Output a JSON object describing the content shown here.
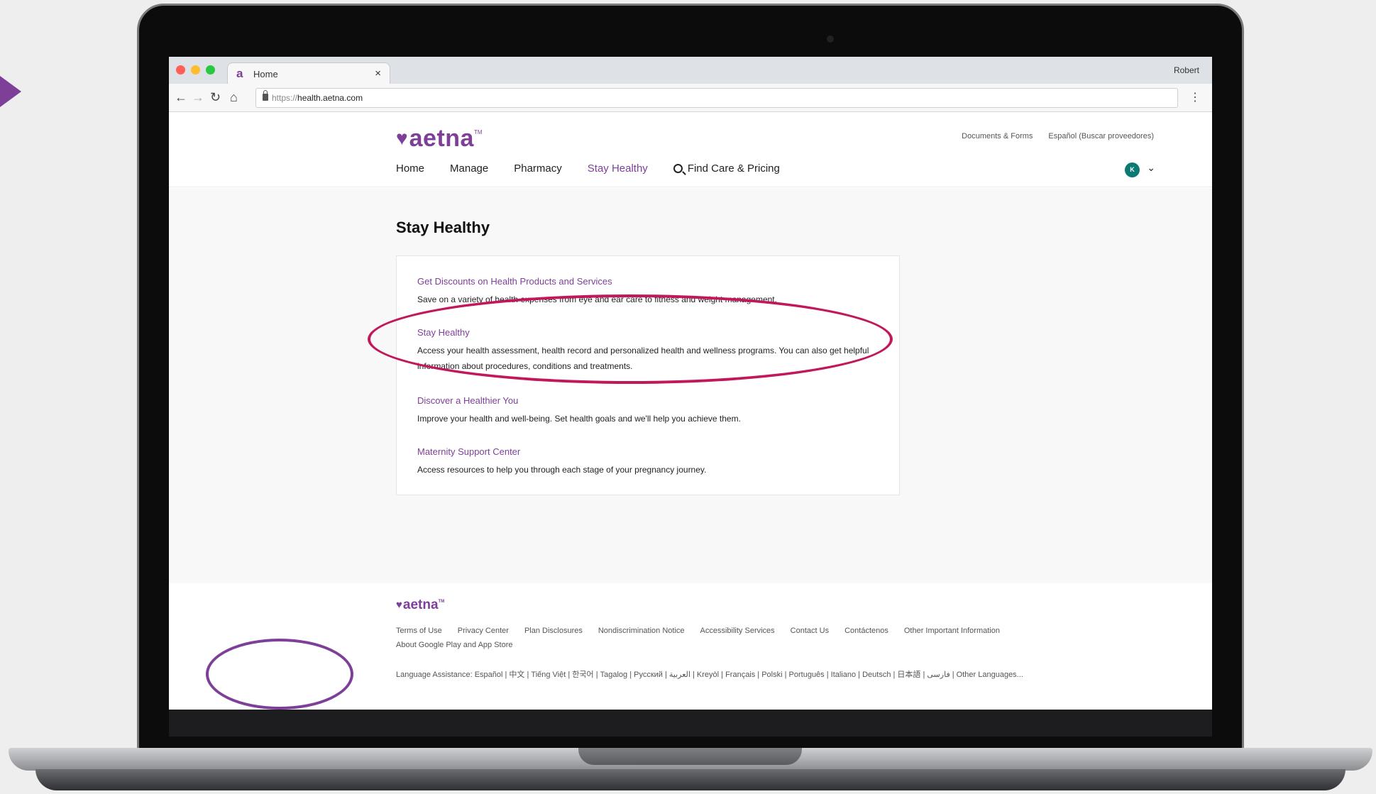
{
  "browser": {
    "tab_title": "Home",
    "tab_favicon": "a",
    "tab_close": "×",
    "profile": "Robert",
    "url_scheme": "https://",
    "url_host": "health.aetna.com",
    "traffic_colors": [
      "#ff5f57",
      "#ffbd2e",
      "#28c840"
    ]
  },
  "header": {
    "logo_text": "aetna",
    "logo_tm": "TM",
    "utility_links": [
      "Documents & Forms",
      "Español (Buscar proveedores)"
    ],
    "nav": [
      "Home",
      "Manage",
      "Pharmacy",
      "Stay Healthy"
    ],
    "nav_search": "Find Care & Pricing",
    "avatar_initial": "K"
  },
  "main": {
    "title": "Stay Healthy",
    "items": [
      {
        "link": "Get Discounts on Health Products and Services",
        "desc": "Save on a variety of health expenses from eye and ear care to fitness and weight management."
      },
      {
        "link": "Stay Healthy",
        "desc": "Access your health assessment, health record and personalized health and wellness programs. You can also get helpful information about procedures, conditions and treatments."
      },
      {
        "link": "Discover a Healthier You",
        "desc": "Improve your health and well-being. Set health goals and we'll help you achieve them."
      },
      {
        "link": "Maternity Support Center",
        "desc": "Access resources to help you through each stage of your pregnancy journey."
      }
    ]
  },
  "footer": {
    "logo_text": "aetna",
    "logo_tm": "TM",
    "links": [
      "Terms of Use",
      "Privacy Center",
      "Plan Disclosures",
      "Nondiscrimination Notice",
      "Accessibility Services",
      "Contact Us",
      "Contáctenos",
      "Other Important Information",
      "About Google Play and App Store"
    ],
    "language_assistance": "Language Assistance: Español | 中文 | Tiếng Việt | 한국어 | Tagalog | Русский | العربية | Kreyòl | Français | Polski | Português | Italiano | Deutsch | 日本語 | فارسی | Other Languages..."
  },
  "colors": {
    "brand": "#7d3f98",
    "highlight": "#c2185b",
    "avatar": "#0b7a75"
  },
  "icons": [
    "back-arrow-icon",
    "forward-arrow-icon",
    "reload-icon",
    "home-icon",
    "lock-icon",
    "menu-dots-icon",
    "search-icon",
    "chevron-down-icon",
    "heart-icon"
  ]
}
